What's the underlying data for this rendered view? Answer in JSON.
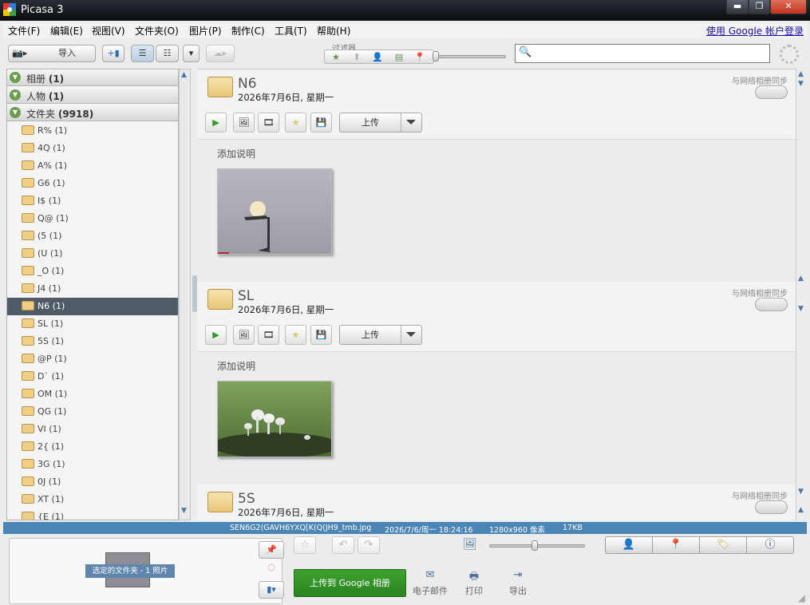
{
  "window": {
    "title": "Picasa 3"
  },
  "menu": {
    "items": [
      "文件(F)",
      "编辑(E)",
      "视图(V)",
      "文件夹(O)",
      "图片(P)",
      "制作(C)",
      "工具(T)",
      "帮助(H)"
    ],
    "login": "使用 Google 帐户登录"
  },
  "toolbar": {
    "import_label": "导入",
    "filter_label": "过滤器"
  },
  "sidebar": {
    "sections": [
      {
        "label": "相册",
        "count": "(1)"
      },
      {
        "label": "人物",
        "count": "(1)"
      },
      {
        "label": "文件夹",
        "count": "(9918)"
      }
    ],
    "folders": [
      "R% (1)",
      "4Q (1)",
      "A% (1)",
      "G6 (1)",
      "I$ (1)",
      "Q@ (1)",
      "(5 (1)",
      "(U (1)",
      "_O (1)",
      "J4 (1)",
      "N6 (1)",
      "SL (1)",
      "5S (1)",
      "@P (1)",
      "D` (1)",
      "OM (1)",
      "QG (1)",
      "VI (1)",
      "2{ (1)",
      "3G (1)",
      "0J (1)",
      "XT (1)",
      "{E (1)"
    ],
    "selected_index": 10
  },
  "albums": [
    {
      "name": "N6",
      "date": "2026年7月6日, 星期一",
      "sync": "与网络相册同步",
      "upload": "上传",
      "caption": "添加说明"
    },
    {
      "name": "SL",
      "date": "2026年7月6日, 星期一",
      "sync": "与网络相册同步",
      "upload": "上传",
      "caption": "添加说明"
    },
    {
      "name": "5S",
      "date": "2026年7月6日, 星期一",
      "sync": "与网络相册同步"
    }
  ],
  "status": {
    "filename": "SEN6G2(GAVH6YXQ[K(Q(JH9_tmb.jpg",
    "datetime": "2026/7/6/周一 18:24:16",
    "dimensions": "1280x960 像素",
    "size": "17KB"
  },
  "tray": {
    "label": "选定的文件夹 - 1 照片"
  },
  "actions": {
    "google_upload": "上传到 Google 相册",
    "email": "电子邮件",
    "print": "打印",
    "export": "导出"
  }
}
